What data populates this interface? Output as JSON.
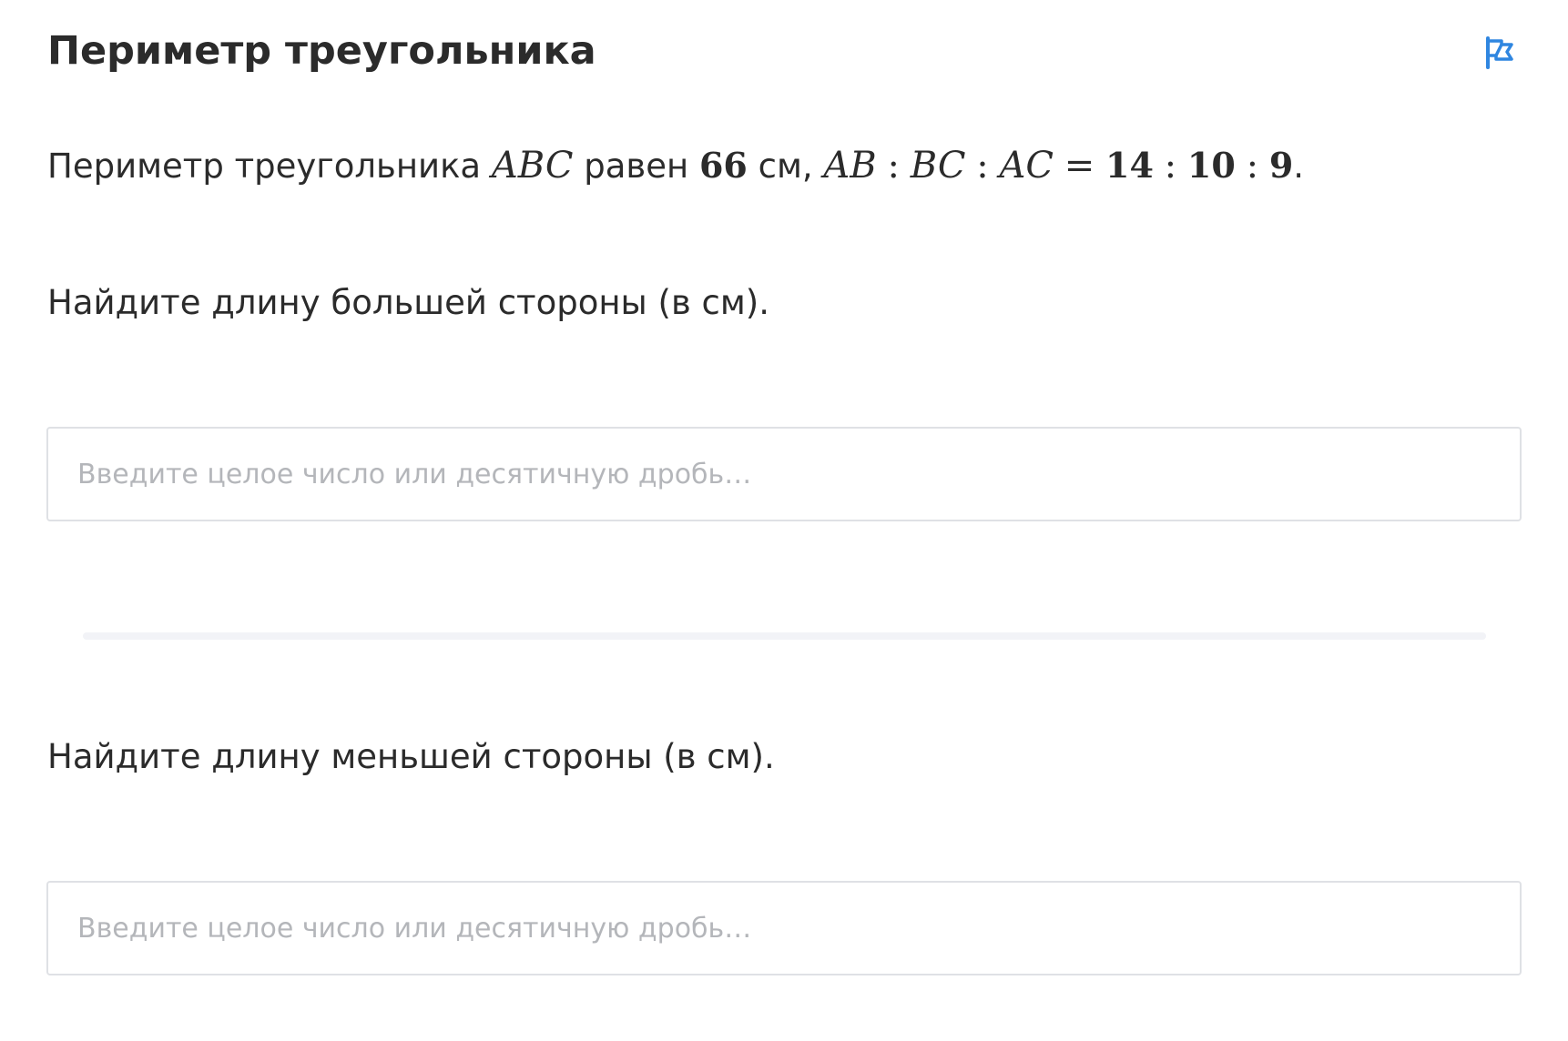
{
  "problem": {
    "title": "Периметр треугольника",
    "flag_icon": "flag-icon",
    "accent_color": "#2f86e0",
    "statement": {
      "text_1": "Периметр треугольника",
      "triangle": "ABC",
      "text_2": "равен",
      "perimeter_value": "66",
      "unit_comma": "см,",
      "seg_ab": "AB",
      "colon": ":",
      "seg_bc": "BC",
      "seg_ac": "AC",
      "equals": "=",
      "ratio_1": "14",
      "ratio_2": "10",
      "ratio_3": "9",
      "period": "."
    }
  },
  "questions": [
    {
      "prompt": "Найдите длину большей стороны (в см).",
      "placeholder": "Введите целое число или десятичную дробь…",
      "value": ""
    },
    {
      "prompt": "Найдите длину меньшей стороны (в см).",
      "placeholder": "Введите целое число или десятичную дробь…",
      "value": ""
    }
  ]
}
